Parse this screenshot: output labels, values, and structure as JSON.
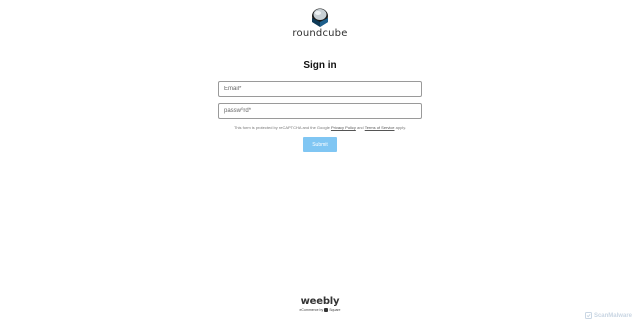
{
  "brand": {
    "name": "roundcube",
    "colors": {
      "cube_dark": "#0f3a57",
      "cube_light": "#9aa8b0"
    }
  },
  "form": {
    "title": "Sign in",
    "email_placeholder": "Email*",
    "password_placeholder": "passw⁰rd*",
    "recaptcha_prefix": "This form is protected by reCAPTCHA and the Google",
    "privacy_link": "Privacy Policy",
    "and_text": "and",
    "terms_link": "Terms of Service",
    "recaptcha_suffix": "apply.",
    "submit_label": "Submit",
    "submit_color": "#80c6f3"
  },
  "footer": {
    "weebly_logo": "weebly",
    "weebly_tagline_prefix": "eCommerce by",
    "weebly_tagline_brand": "Square"
  },
  "watermark": {
    "text": "ScanMalware",
    "icon": "scanmalware-logo-icon"
  }
}
